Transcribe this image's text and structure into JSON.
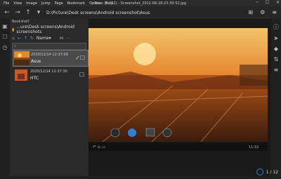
{
  "menu": [
    "File",
    "View",
    "Image",
    "Jump",
    "Page",
    "Bookmark",
    "Option",
    "Help"
  ],
  "window_title": "Asus (1 / 12) - Screenshot_2012-06-18-23-30-52.jpg",
  "path": "D:\\Picture\\Desk screens\\Android screenshot\\Asus",
  "sidebar": {
    "title": "Bookshelf",
    "path": "...ure\\Desk screens\\Android screenshots",
    "sort_label": "Name",
    "items": [
      {
        "date": "2020/12/14 12:37:09",
        "name": "Asus"
      },
      {
        "date": "2020/12/14 12:37:30",
        "name": "HTC"
      }
    ]
  },
  "pager": "1 / 12",
  "phone_status_time": "11:32",
  "icons": {
    "back": "back-arrow-icon",
    "forward": "forward-arrow-icon",
    "up": "up-arrow-icon"
  }
}
